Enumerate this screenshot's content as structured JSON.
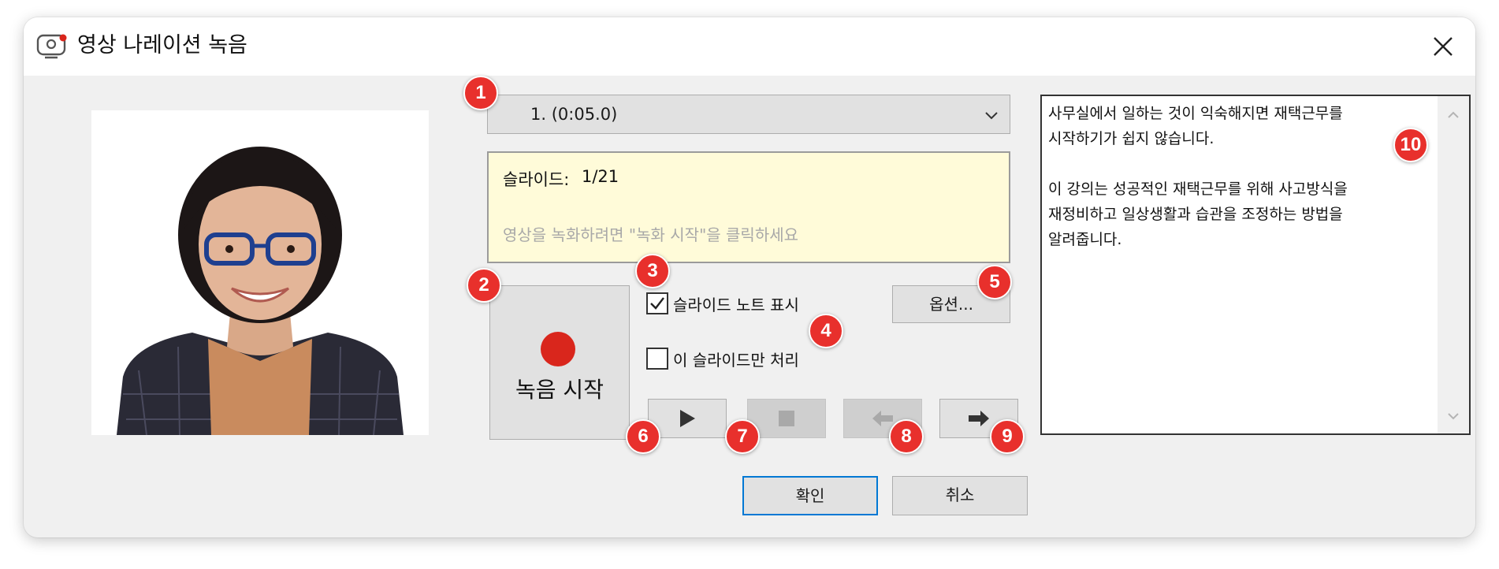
{
  "window": {
    "title": "영상 나레이션 녹음",
    "icon": "webcam-icon",
    "close_icon": "close-icon"
  },
  "photo": {
    "description_icon": "presenter-photo"
  },
  "clip_selector": {
    "value": "1. (0:05.0)",
    "icon": "chevron-down-icon"
  },
  "info": {
    "slide_label": "슬라이드:",
    "slide_value": "1/21",
    "hint": "영상을 녹화하려면 \"녹화 시작\"을 클릭하세요"
  },
  "record": {
    "label": "녹음 시작",
    "dot_color": "#d9261c"
  },
  "checkboxes": {
    "show_notes": {
      "label": "슬라이드 노트 표시",
      "checked": true
    },
    "this_slide_only": {
      "label": "이 슬라이드만 처리",
      "checked": false
    }
  },
  "options_button": {
    "label": "옵션..."
  },
  "controls": {
    "play": {
      "icon": "play-icon",
      "enabled": true
    },
    "stop": {
      "icon": "stop-icon",
      "enabled": false
    },
    "previous": {
      "icon": "arrow-left-icon",
      "enabled": false
    },
    "next": {
      "icon": "arrow-right-icon",
      "enabled": true
    }
  },
  "footer": {
    "ok_label": "확인",
    "cancel_label": "취소"
  },
  "notes": {
    "text": "사무실에서 일하는 것이 익숙해지면 재택근무를\n시작하기가 쉽지 않습니다.\n\n이 강의는 성공적인 재택근무를 위해 사고방식을\n재정비하고 일상생활과 습관을 조정하는 방법을\n알려줍니다."
  },
  "callouts": [
    "1",
    "2",
    "3",
    "4",
    "5",
    "6",
    "7",
    "8",
    "9",
    "10"
  ],
  "colors": {
    "accent": "#0078d4",
    "callout": "#e8302c",
    "info_bg": "#fffbd9"
  }
}
